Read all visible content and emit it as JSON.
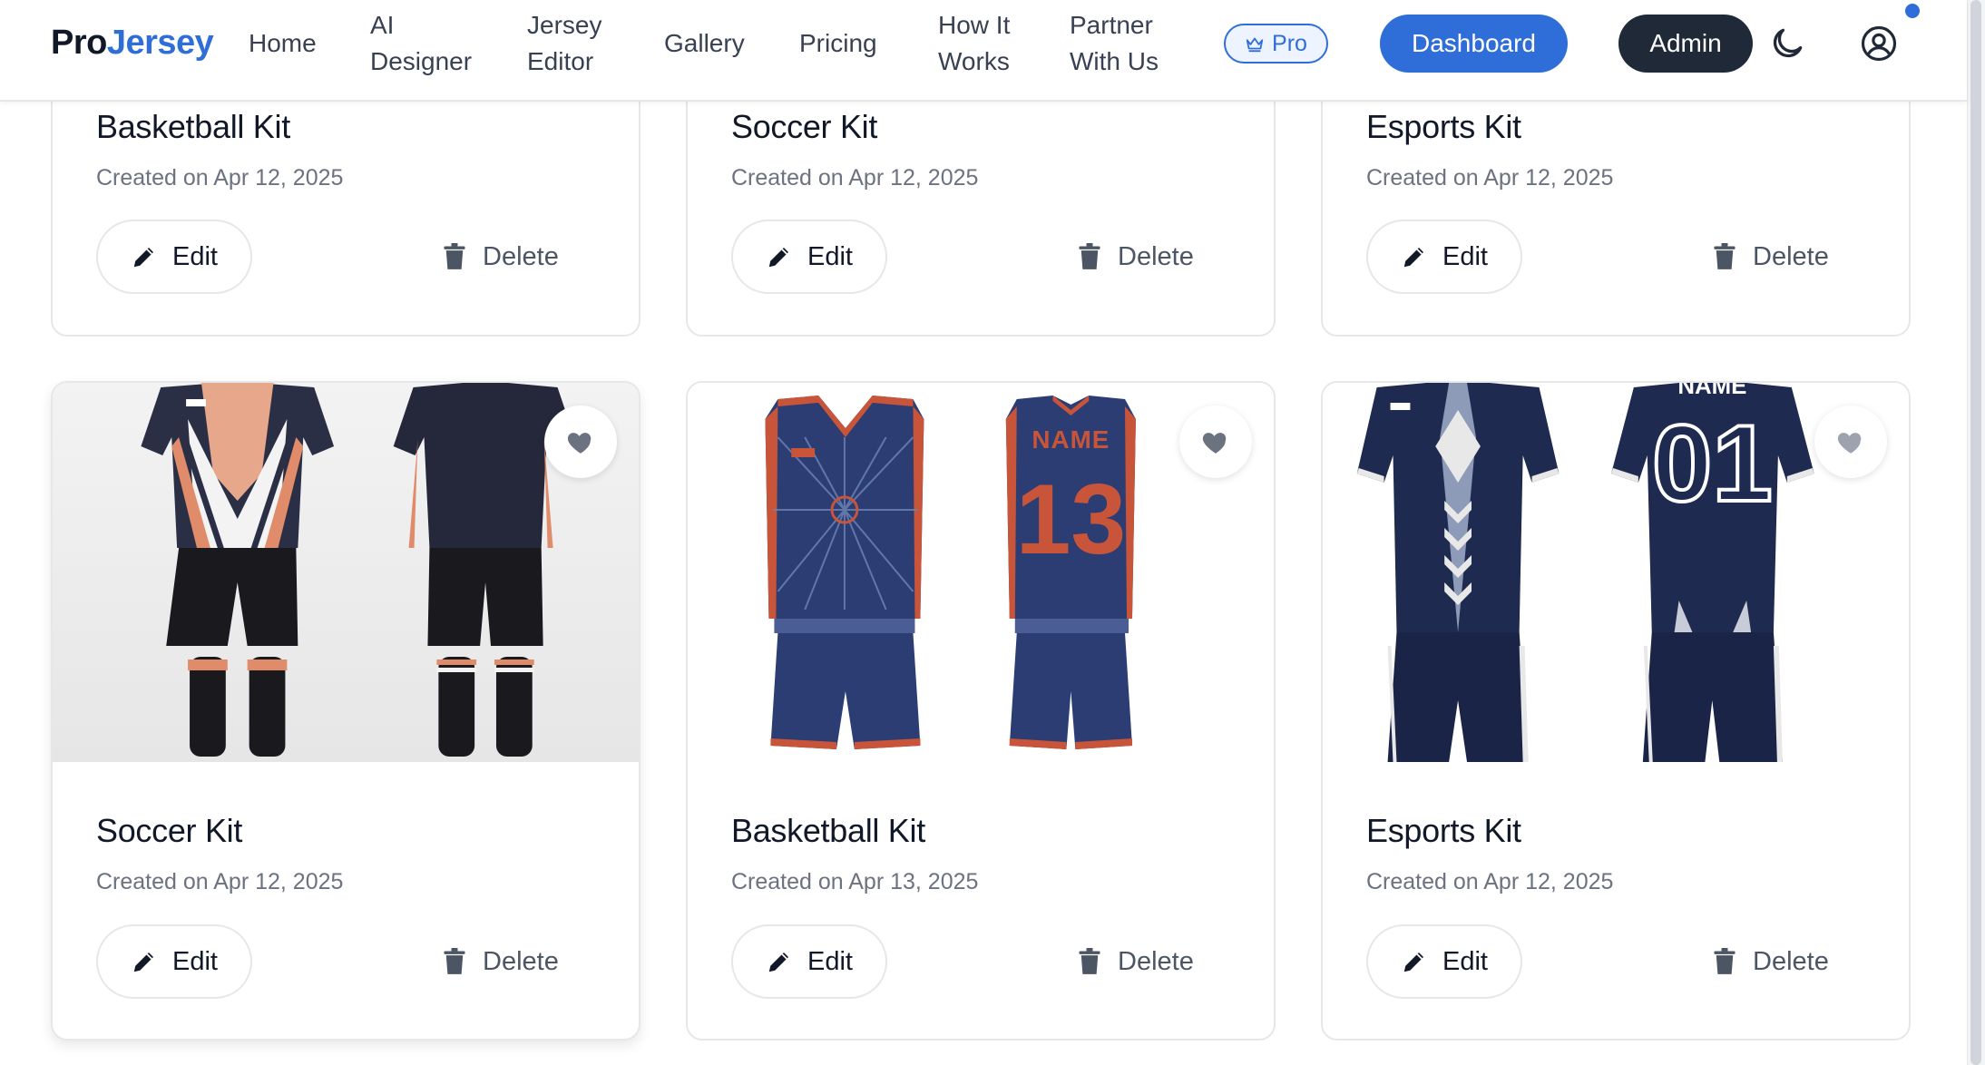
{
  "brand": {
    "part1": "Pro",
    "part2": "Jersey"
  },
  "nav": {
    "home": "Home",
    "ai_designer_line1": "AI",
    "ai_designer_line2": "Designer",
    "jersey_editor_line1": "Jersey",
    "jersey_editor_line2": "Editor",
    "gallery": "Gallery",
    "pricing": "Pricing",
    "how_it_works_line1": "How It",
    "how_it_works_line2": "Works",
    "partner_line1": "Partner",
    "partner_line2": "With Us",
    "pro_badge": "Pro",
    "dashboard": "Dashboard",
    "admin": "Admin"
  },
  "icons": {
    "theme_toggle": "moon-icon",
    "account": "user-circle-icon",
    "edit": "pencil-icon",
    "delete": "trash-icon",
    "favorite": "heart-icon",
    "pro": "crown-icon"
  },
  "colors": {
    "accent": "#2f6ed8",
    "admin": "#1f2937",
    "navy": "#1e2d5c",
    "orange": "#c8553a"
  },
  "actions": {
    "edit_label": "Edit",
    "delete_label": "Delete"
  },
  "designs": [
    {
      "title": "Basketball Kit",
      "date": "Created on Apr 12, 2025"
    },
    {
      "title": "Soccer Kit",
      "date": "Created on Apr 12, 2025"
    },
    {
      "title": "Esports Kit",
      "date": "Created on Apr 12, 2025"
    },
    {
      "title": "Soccer Kit",
      "date": "Created on Apr 12, 2025",
      "image_label": ""
    },
    {
      "title": "Basketball Kit",
      "date": "Created on Apr 13, 2025",
      "jersey_name": "NAME",
      "jersey_number": "13"
    },
    {
      "title": "Esports Kit",
      "date": "Created on Apr 12, 2025",
      "jersey_name": "NAME",
      "jersey_number": "01"
    }
  ]
}
